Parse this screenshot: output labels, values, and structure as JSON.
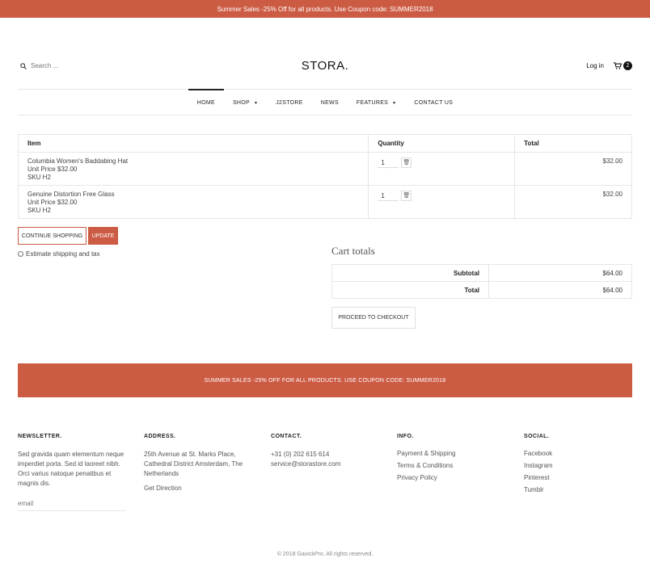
{
  "topbar": {
    "text": "Summer Sales -25% Off for all products. Use Coupon code: SUMMER2018"
  },
  "header": {
    "search_placeholder": "Search ...",
    "logo": "STORA.",
    "login": "Log in",
    "cart_count": "2"
  },
  "nav": {
    "items": [
      {
        "label": "HOME",
        "active": true
      },
      {
        "label": "SHOP",
        "dropdown": true
      },
      {
        "label": "J2STORE"
      },
      {
        "label": "NEWS"
      },
      {
        "label": "FEATURES",
        "dropdown": true
      },
      {
        "label": "CONTACT US"
      }
    ]
  },
  "cart": {
    "headers": {
      "item": "Item",
      "quantity": "Quantity",
      "total": "Total"
    },
    "rows": [
      {
        "name": "Columbia Women's Baddabing Hat",
        "unit_price": "Unit Price $32.00",
        "sku": "SKU H2",
        "qty": "1",
        "total": "$32.00"
      },
      {
        "name": "Genuine Distortion Free Glass",
        "unit_price": "Unit Price $32.00",
        "sku": "SKU H2",
        "qty": "1",
        "total": "$32.00"
      }
    ],
    "continue_label": "CONTINUE SHOPPING",
    "update_label": "UPDATE",
    "estimate_label": "Estimate shipping and tax"
  },
  "totals": {
    "title": "Cart totals",
    "subtotal_label": "Subtotal",
    "subtotal_value": "$64.00",
    "total_label": "Total",
    "total_value": "$64.00",
    "checkout_label": "PROCEED TO CHECKOUT"
  },
  "promo": {
    "text": "SUMMER SALES -25% OFF FOR ALL PRODUCTS. USE COUPON CODE: SUMMER2018"
  },
  "footer": {
    "newsletter": {
      "title": "NEWSLETTER.",
      "text": "Sed gravida quam elementum neque imperdiet porta. Sed id laoreet nibh. Orci varius natoque penatibus et magnis dis.",
      "placeholder": "email"
    },
    "address": {
      "title": "ADDRESS.",
      "text": "25th Avenue at St. Marks Place, Cathedral District Amsterdam, The Netherlands",
      "link": "Get Direction"
    },
    "contact": {
      "title": "CONTACT.",
      "phone": "+31 (0) 202 615 614",
      "email": "service@storastore.com"
    },
    "info": {
      "title": "INFO.",
      "links": [
        "Payment & Shipping",
        "Terms & Conditions",
        "Privacy Policy"
      ]
    },
    "social": {
      "title": "SOCIAL.",
      "links": [
        "Facebook",
        "Instagram",
        "Pinterest",
        "Tumblr"
      ]
    },
    "copyright": "© 2018 GavickPro. All rights reserved."
  },
  "colors": {
    "accent": "#cc5b44",
    "text": "#333333",
    "border": "#e6e6e6"
  }
}
